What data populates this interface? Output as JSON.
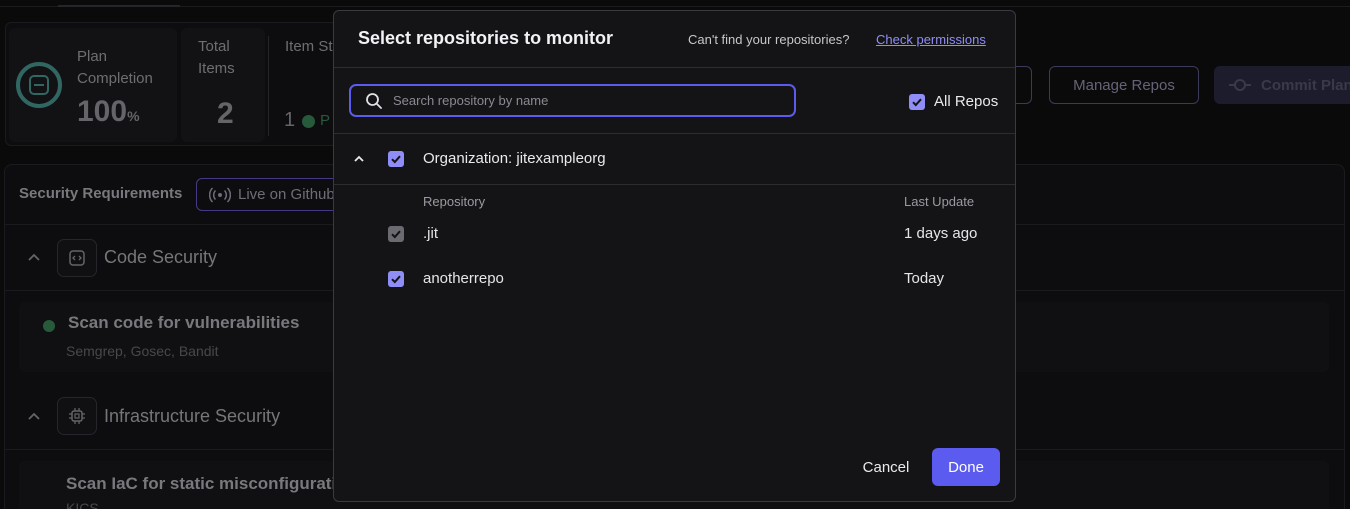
{
  "background": {
    "stats": {
      "plan_label": "Plan Completion",
      "plan_value": "100",
      "plan_unit": "%",
      "total_label": "Total Items",
      "total_value": "2",
      "item_status_label": "Item St",
      "item_status_count": "1",
      "item_status_pass": "P"
    },
    "buttons": {
      "manage_repos": "Manage Repos",
      "commit_plan": "Commit Plan"
    },
    "requirements": {
      "title": "Security Requirements",
      "live_badge": "Live on Github"
    },
    "sections": [
      {
        "title": "Code Security",
        "item_title": "Scan code for vulnerabilities",
        "item_tools": "Semgrep, Gosec, Bandit"
      },
      {
        "title": "Infrastructure Security",
        "item_title": "Scan IaC for static misconfigurati",
        "item_tools": "KICS"
      }
    ]
  },
  "modal": {
    "title": "Select repositories to monitor",
    "help_text": "Can't find your repositories?",
    "help_link": "Check permissions",
    "search_placeholder": "Search repository by name",
    "search_value": "",
    "all_repos_label": "All Repos",
    "all_repos_checked": true,
    "organization": {
      "label": "Organization: jitexampleorg",
      "checked": true,
      "expanded": true
    },
    "columns": {
      "repository": "Repository",
      "last_update": "Last Update"
    },
    "repos": [
      {
        "name": ".jit",
        "last_update": "1 days ago",
        "checked": true,
        "disabled": true
      },
      {
        "name": "anotherrepo",
        "last_update": "Today",
        "checked": true,
        "disabled": false
      }
    ],
    "cancel_label": "Cancel",
    "done_label": "Done"
  },
  "colors": {
    "accent": "#5b5bf0",
    "checkbox": "#8f8ef6",
    "link": "#8e8ef4",
    "success": "#3c8a5a",
    "plan_ring": "#4a9e98"
  }
}
